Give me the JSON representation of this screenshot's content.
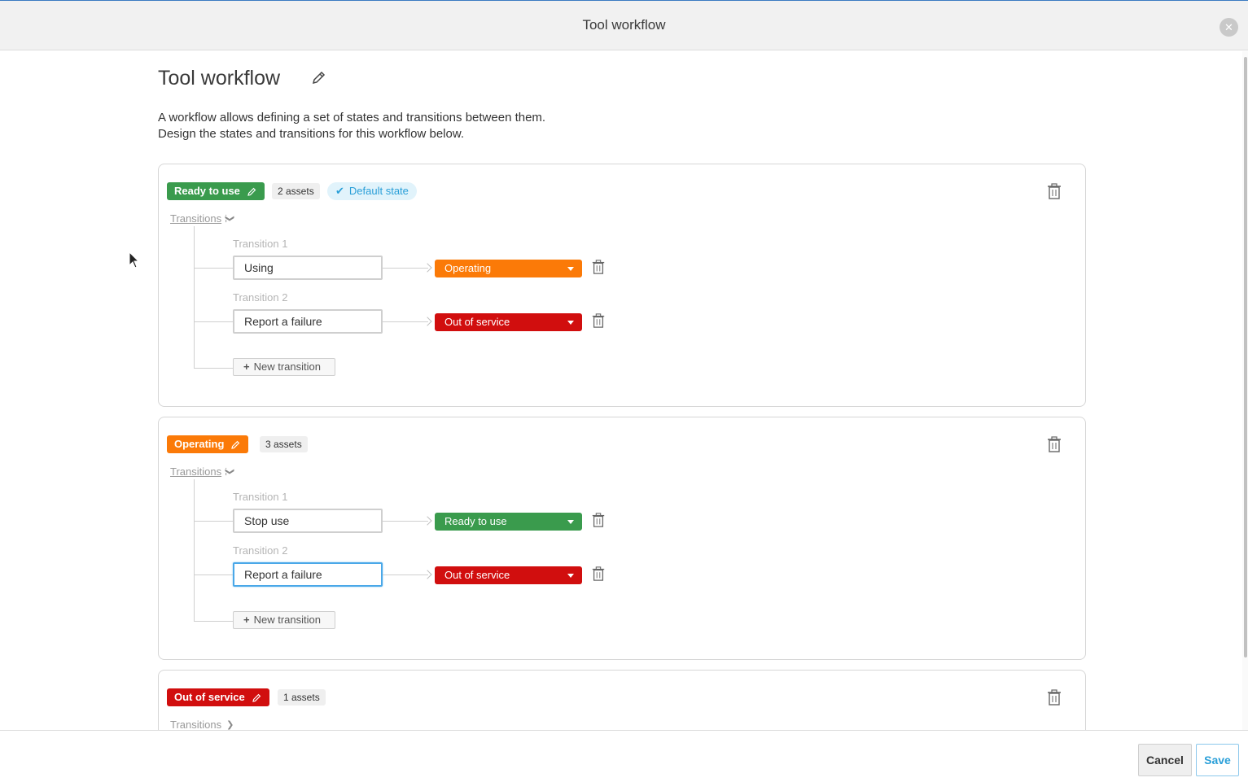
{
  "window": {
    "title": "Tool workflow",
    "close_icon": "close-icon"
  },
  "page": {
    "title": "Tool workflow",
    "description_line1": "A workflow allows defining a set of states and transitions between them.",
    "description_line2": "Design the states and transitions for this workflow below."
  },
  "colors": {
    "green": "#3a9b4d",
    "orange": "#fb7a08",
    "red": "#d10e0e",
    "blue": "#2a9fd8"
  },
  "states": [
    {
      "name": "Ready to use",
      "color": "#3a9b4d",
      "assets": "2 assets",
      "default_label": "Default state",
      "transitions_label": "Transitions",
      "expanded": true,
      "transitions": [
        {
          "label": "Transition 1",
          "name": "Using",
          "target": "Operating",
          "target_color": "#fb7a08"
        },
        {
          "label": "Transition 2",
          "name": "Report a failure",
          "target": "Out of service",
          "target_color": "#d10e0e"
        }
      ],
      "new_transition_label": "New transition"
    },
    {
      "name": "Operating",
      "color": "#fb7a08",
      "assets": "3 assets",
      "transitions_label": "Transitions",
      "expanded": true,
      "transitions": [
        {
          "label": "Transition 1",
          "name": "Stop use",
          "target": "Ready to use",
          "target_color": "#3a9b4d"
        },
        {
          "label": "Transition 2",
          "name": "Report a failure",
          "target": "Out of service",
          "target_color": "#d10e0e"
        }
      ],
      "new_transition_label": "New transition"
    },
    {
      "name": "Out of service",
      "color": "#d10e0e",
      "assets": "1 assets",
      "transitions_label": "Transitions",
      "expanded": false
    }
  ],
  "footer": {
    "cancel_label": "Cancel",
    "save_label": "Save"
  }
}
